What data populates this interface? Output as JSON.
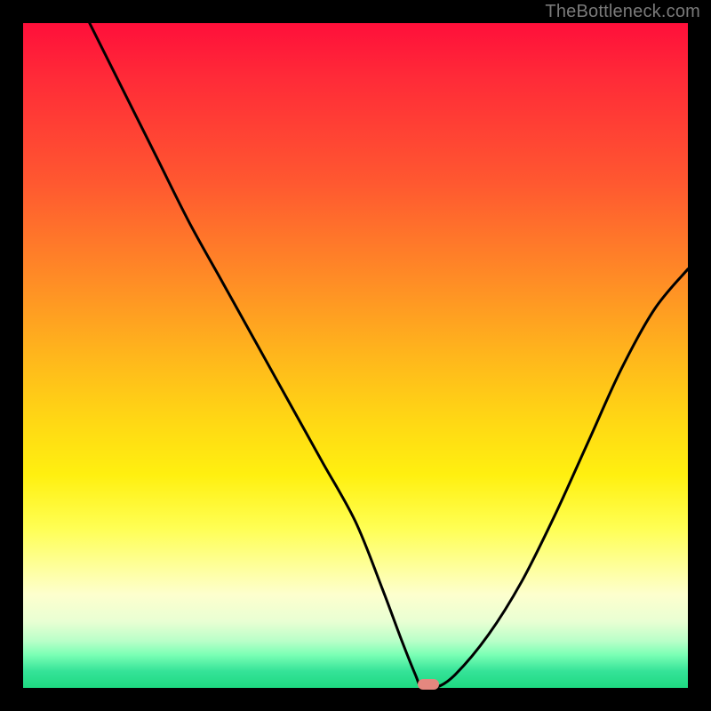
{
  "attribution": "TheBottleneck.com",
  "chart_data": {
    "type": "line",
    "title": "",
    "xlabel": "",
    "ylabel": "",
    "xlim": [
      0,
      100
    ],
    "ylim": [
      0,
      100
    ],
    "grid": false,
    "legend": false,
    "series": [
      {
        "name": "bottleneck-curve",
        "x": [
          10,
          15,
          20,
          25,
          30,
          35,
          40,
          45,
          50,
          54,
          57,
          59,
          60,
          62,
          65,
          70,
          75,
          80,
          85,
          90,
          95,
          100
        ],
        "y": [
          100,
          90,
          80,
          70,
          61,
          52,
          43,
          34,
          25,
          15,
          7,
          2,
          0,
          0,
          2,
          8,
          16,
          26,
          37,
          48,
          57,
          63
        ]
      }
    ],
    "annotations": [
      {
        "name": "optimal-marker",
        "x": 61,
        "y": 0,
        "color": "#e5877f"
      }
    ],
    "background_gradient": {
      "top": "#ff0f3a",
      "mid": "#ffe000",
      "bottom": "#1ed981"
    }
  }
}
